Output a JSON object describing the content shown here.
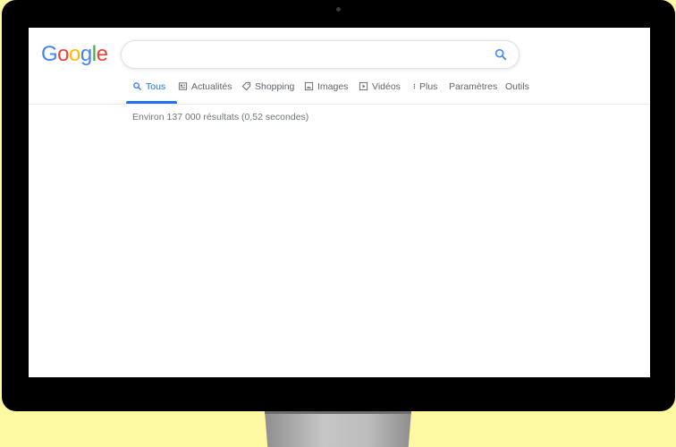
{
  "logo": {
    "letters": [
      "G",
      "o",
      "o",
      "g",
      "l",
      "e"
    ],
    "colors": [
      "#4285F4",
      "#EA4335",
      "#FBBC05",
      "#4285F4",
      "#34A853",
      "#EA4335"
    ]
  },
  "search": {
    "value": "",
    "placeholder": ""
  },
  "tabs": [
    {
      "label": "Tous",
      "icon": "search-icon",
      "active": true
    },
    {
      "label": "Actualités",
      "icon": "news-icon",
      "active": false
    },
    {
      "label": "Shopping",
      "icon": "tag-icon",
      "active": false
    },
    {
      "label": "Images",
      "icon": "image-icon",
      "active": false
    },
    {
      "label": "Vidéos",
      "icon": "play-icon",
      "active": false
    },
    {
      "label": "Plus",
      "icon": "more-vertical-icon",
      "active": false
    },
    {
      "label": "Paramètres",
      "icon": "",
      "active": false
    },
    {
      "label": "Outils",
      "icon": "",
      "active": false
    }
  ],
  "results": {
    "stats": "Environ 137 000 résultats (0,52 secondes)"
  },
  "colors": {
    "accent": "#1a73e8",
    "background": "#fdf9a3",
    "bezel": "#000000"
  }
}
